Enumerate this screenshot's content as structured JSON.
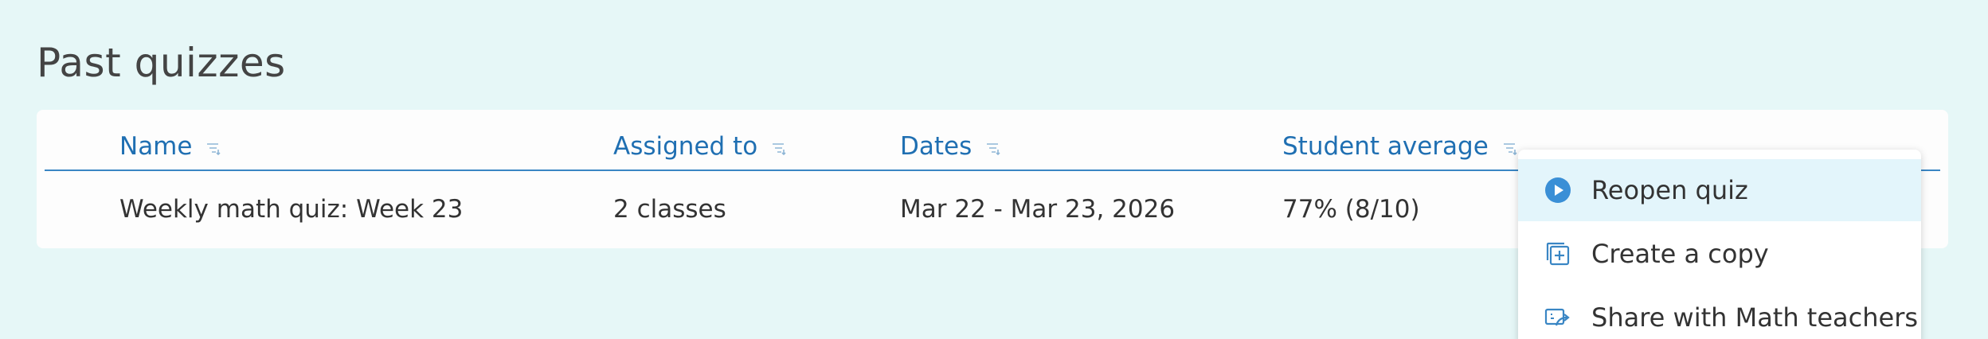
{
  "page": {
    "title": "Past quizzes"
  },
  "table": {
    "columns": [
      "Name",
      "Assigned to",
      "Dates",
      "Student average"
    ],
    "rows": [
      {
        "name": "Weekly math quiz: Week 23",
        "assigned_to": "2 classes",
        "dates": "Mar 22 - Mar 23, 2026",
        "average": "77% (8/10)"
      }
    ]
  },
  "menu": {
    "items": [
      {
        "label": "Reopen quiz",
        "icon": "play-circle-icon"
      },
      {
        "label": "Create a copy",
        "icon": "copy-plus-icon"
      },
      {
        "label": "Share with Math teachers",
        "icon": "share-icon"
      }
    ]
  },
  "colors": {
    "accent": "#1f6fb2",
    "background": "#e6f7f7",
    "menu_active": "#e3f5fb",
    "focus": "#5fc4de"
  }
}
